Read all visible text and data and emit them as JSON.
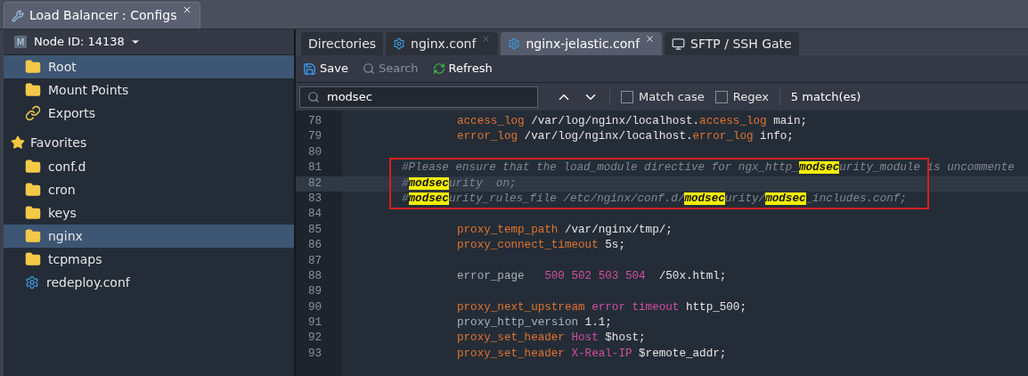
{
  "window_tab": {
    "title": "Load Balancer : Configs"
  },
  "node_selector": {
    "badge": "M",
    "label": "Node ID: 14138"
  },
  "tree": [
    {
      "label": "Root",
      "kind": "folder",
      "selected": true
    },
    {
      "label": "Mount Points",
      "kind": "mount",
      "selected": false
    },
    {
      "label": "Exports",
      "kind": "export",
      "selected": false
    },
    {
      "label": "Favorites",
      "kind": "heading",
      "selected": false
    },
    {
      "label": "conf.d",
      "kind": "folder",
      "selected": false
    },
    {
      "label": "cron",
      "kind": "folder",
      "selected": false
    },
    {
      "label": "keys",
      "kind": "folder",
      "selected": false
    },
    {
      "label": "nginx",
      "kind": "folder",
      "selected": true
    },
    {
      "label": "tcpmaps",
      "kind": "folder",
      "selected": false
    },
    {
      "label": "redeploy.conf",
      "kind": "file",
      "selected": false
    }
  ],
  "tabs": [
    {
      "label": "Directories",
      "kind": "plain",
      "selected": false,
      "closable": false
    },
    {
      "label": "nginx.conf",
      "kind": "file",
      "selected": false,
      "closable": true
    },
    {
      "label": "nginx-jelastic.conf",
      "kind": "file",
      "selected": true,
      "closable": true
    },
    {
      "label": "SFTP / SSH Gate",
      "kind": "terminal",
      "selected": false,
      "closable": false
    }
  ],
  "toolbar": [
    {
      "label": "Save",
      "kind": "save",
      "disabled": false
    },
    {
      "label": "Search",
      "kind": "search",
      "disabled": true
    },
    {
      "label": "Refresh",
      "kind": "refresh",
      "disabled": false
    }
  ],
  "search_bar": {
    "value": "modsec",
    "match_case": {
      "label": "Match case",
      "checked": false
    },
    "regex": {
      "label": "Regex",
      "checked": false
    },
    "result": "5 match(es)"
  },
  "code_lines": [
    {
      "number": "78",
      "kind": "code",
      "current": false,
      "boxed": false,
      "tokens": [
        {
          "text": "access_log",
          "kind": "directive"
        },
        {
          "text": " /var/log/nginx/localhost.",
          "kind": "plain"
        },
        {
          "text": "access_log",
          "kind": "directive"
        },
        {
          "text": " main;",
          "kind": "plain"
        }
      ]
    },
    {
      "number": "79",
      "kind": "code",
      "current": false,
      "boxed": false,
      "tokens": [
        {
          "text": "error_log",
          "kind": "directive"
        },
        {
          "text": " /var/log/nginx/localhost.",
          "kind": "plain"
        },
        {
          "text": "error_log",
          "kind": "directive"
        },
        {
          "text": " info;",
          "kind": "plain"
        }
      ]
    },
    {
      "number": "80",
      "kind": "blank",
      "current": false,
      "boxed": false
    },
    {
      "number": "81",
      "kind": "comment",
      "current": false,
      "boxed": true,
      "tokens": [
        {
          "text": "#Please ensure that the load_module directive for ngx_http_",
          "kind": "comment"
        },
        {
          "text": "modsec",
          "kind": "match"
        },
        {
          "text": "urity_module is uncommente",
          "kind": "comment"
        }
      ]
    },
    {
      "number": "82",
      "kind": "comment",
      "current": true,
      "boxed": true,
      "tokens": [
        {
          "text": "#",
          "kind": "comment"
        },
        {
          "text": "modsec",
          "kind": "match"
        },
        {
          "text": "urity  on;",
          "kind": "comment"
        }
      ]
    },
    {
      "number": "83",
      "kind": "comment",
      "current": false,
      "boxed": true,
      "tokens": [
        {
          "text": "#",
          "kind": "comment"
        },
        {
          "text": "modsec",
          "kind": "match"
        },
        {
          "text": "urity_rules_file /etc/nginx/conf.d/",
          "kind": "comment"
        },
        {
          "text": "modsec",
          "kind": "match"
        },
        {
          "text": "urity/",
          "kind": "comment"
        },
        {
          "text": "modsec",
          "kind": "match"
        },
        {
          "text": "_includes.conf;",
          "kind": "comment"
        }
      ]
    },
    {
      "number": "84",
      "kind": "blank",
      "current": false,
      "boxed": false
    },
    {
      "number": "85",
      "kind": "code",
      "current": false,
      "boxed": false,
      "tokens": [
        {
          "text": "proxy_temp_path",
          "kind": "directive"
        },
        {
          "text": " /var/nginx/tmp/;",
          "kind": "plain"
        }
      ]
    },
    {
      "number": "86",
      "kind": "code",
      "current": false,
      "boxed": false,
      "tokens": [
        {
          "text": "proxy_connect_timeout",
          "kind": "directive"
        },
        {
          "text": " 5s;",
          "kind": "plain"
        }
      ]
    },
    {
      "number": "87",
      "kind": "blank",
      "current": false,
      "boxed": false
    },
    {
      "number": "88",
      "kind": "code",
      "current": false,
      "boxed": false,
      "tokens": [
        {
          "text": "error_page",
          "kind": "muted"
        },
        {
          "text": "   500 502 503 504",
          "kind": "keyword"
        },
        {
          "text": "  /50x.html;",
          "kind": "plain"
        }
      ]
    },
    {
      "number": "89",
      "kind": "blank",
      "current": false,
      "boxed": false
    },
    {
      "number": "90",
      "kind": "code",
      "current": false,
      "boxed": false,
      "tokens": [
        {
          "text": "proxy_next_upstream",
          "kind": "directive"
        },
        {
          "text": " error timeout",
          "kind": "keyword"
        },
        {
          "text": " http_500;",
          "kind": "plain"
        }
      ]
    },
    {
      "number": "91",
      "kind": "code",
      "current": false,
      "boxed": false,
      "tokens": [
        {
          "text": "proxy_http_version",
          "kind": "muted"
        },
        {
          "text": " 1.1;",
          "kind": "plain"
        }
      ]
    },
    {
      "number": "92",
      "kind": "code",
      "current": false,
      "boxed": false,
      "tokens": [
        {
          "text": "proxy_set_header",
          "kind": "directive"
        },
        {
          "text": " Host",
          "kind": "keyword"
        },
        {
          "text": " $host;",
          "kind": "plain"
        }
      ]
    },
    {
      "number": "93",
      "kind": "code",
      "current": false,
      "boxed": false,
      "tokens": [
        {
          "text": "proxy_set_header",
          "kind": "directive"
        },
        {
          "text": " X-Real-IP",
          "kind": "keyword"
        },
        {
          "text": " $remote_addr;",
          "kind": "plain"
        }
      ]
    }
  ]
}
